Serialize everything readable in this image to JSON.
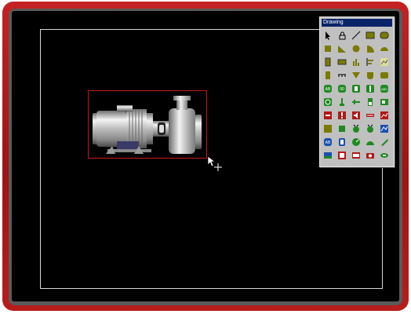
{
  "palette": {
    "title": "Drawing",
    "tools": [
      [
        "arrow-tool",
        "lock-tool",
        "line-tool",
        "rectangle-tool",
        "rounded-rectangle-tool"
      ],
      [
        "filled-rect-tool",
        "triangle-tool",
        "circle-tool",
        "sector-tool",
        "semicircle-tool"
      ],
      [
        "indicator-tool",
        "lamp-tool",
        "bar-chart-tool",
        "level-chart-tool",
        "trend-tool"
      ],
      [
        "meter-tool",
        "scale-tool",
        "valve-tool",
        "tank-tool",
        "numeric-display-tool"
      ],
      [
        "ascii-display-tool",
        "numeric-input-tool",
        "toggle-button-tool",
        "switch-tool",
        "ascii-input-tool"
      ],
      [
        "clock-tool",
        "pipe-tool",
        "slider-tool",
        "gauge-bar-tool",
        "battery-tool"
      ],
      [
        "recipe-tool",
        "alarm-tool",
        "sound-tool",
        "bit-lamp-tool",
        "data-chart-tool"
      ],
      [
        "pie-tool",
        "block-tool",
        "motor-tool",
        "fan-tool",
        "xy-chart-tool"
      ],
      [
        "text-tool",
        "word-tool",
        "dial-tool",
        "speedometer-tool",
        "needle-tool"
      ],
      [
        "picture-tool",
        "report-tool",
        "display-tool",
        "camera-tool",
        "link-tool"
      ]
    ]
  }
}
